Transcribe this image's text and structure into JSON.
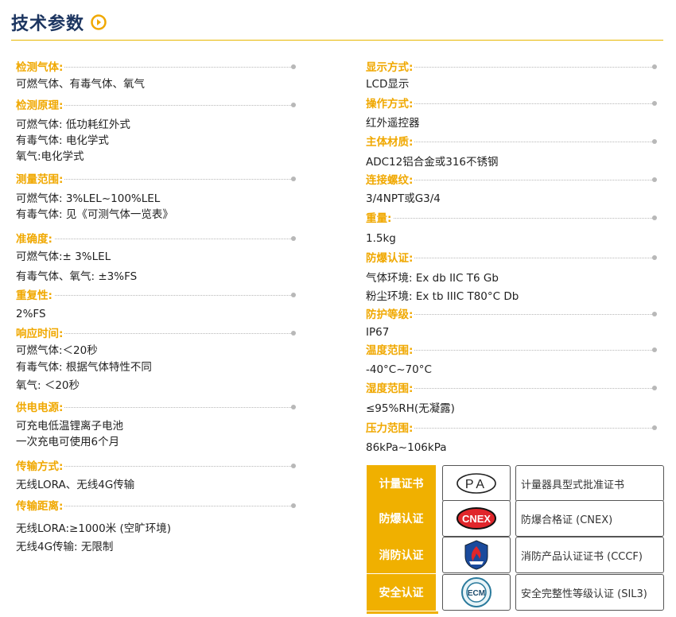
{
  "header": {
    "title": "技术参数"
  },
  "left": [
    {
      "label": "检测气体:",
      "values": [
        "可燃气体、有毒气体、氧气"
      ]
    },
    {
      "label": "检测原理:",
      "values": [
        "可燃气体: 低功耗红外式",
        "有毒气体: 电化学式",
        "氧气:电化学式"
      ]
    },
    {
      "label": "测量范围:",
      "values": [
        "可燃气体:  3%LEL~100%LEL",
        "有毒气体: 见《可测气体一览表》"
      ]
    },
    {
      "label": "准确度:",
      "values": [
        "可燃气体:± 3%LEL",
        "有毒气体、氧气:  ±3%FS"
      ]
    },
    {
      "label": "重复性:",
      "values": [
        "2%FS"
      ]
    },
    {
      "label": "响应时间:",
      "values": [
        "可燃气体:＜20秒",
        "有毒气体: 根据气体特性不同",
        "氧气: ＜20秒"
      ]
    },
    {
      "label": "供电电源:",
      "values": [
        "可充电低温锂离子电池",
        "一次充电可使用6个月"
      ]
    },
    {
      "label": "传输方式:",
      "values": [
        "无线LORA、无线4G传输"
      ]
    },
    {
      "label": "传输距离:",
      "values": [
        "无线LORA:≥1000米 (空旷环境)",
        "无线4G传输: 无限制"
      ]
    }
  ],
  "right": [
    {
      "label": "显示方式:",
      "values": [
        "LCD显示"
      ]
    },
    {
      "label": "操作方式:",
      "values": [
        "红外遥控器"
      ]
    },
    {
      "label": "主体材质:",
      "values": [
        "ADC12铝合金或316不锈钢"
      ]
    },
    {
      "label": "连接螺纹:",
      "values": [
        "3/4NPT或G3/4"
      ]
    },
    {
      "label": "重量:",
      "values": [
        "1.5kg"
      ]
    },
    {
      "label": "防爆认证:",
      "values": [
        "气体环境: Ex db IIC T6 Gb",
        "粉尘环境: Ex tb IIIC T80°C Db"
      ]
    },
    {
      "label": "防护等级:",
      "values": [
        "IP67"
      ]
    },
    {
      "label": "温度范围:",
      "values": [
        "-40°C~70°C"
      ]
    },
    {
      "label": "湿度范围:",
      "values": [
        "≤95%RH(无凝露)"
      ]
    },
    {
      "label": "压力范围:",
      "values": [
        "86kPa~106kPa"
      ]
    }
  ],
  "certs": [
    {
      "label": "计量证书",
      "logo_text": "PA",
      "logo_icon": "cmc-pa-logo",
      "name": "计量器具型式批准证书"
    },
    {
      "label": "防爆认证",
      "logo_text": "CNEX",
      "logo_icon": "cnex-logo",
      "name": "防爆合格证 (CNEX)"
    },
    {
      "label": "消防认证",
      "logo_text": "",
      "logo_icon": "cccf-fire-logo",
      "name": "消防产品认证证书 (CCCF)"
    },
    {
      "label": "安全认证",
      "logo_text": "ECM",
      "logo_icon": "ecm-sil-logo",
      "name": "安全完整性等级认证 (SIL3)"
    }
  ],
  "colors": {
    "accent": "#f0a800",
    "title": "#1c3560",
    "cert_bg": "#f0b000",
    "cnex_red": "#e0262b"
  }
}
